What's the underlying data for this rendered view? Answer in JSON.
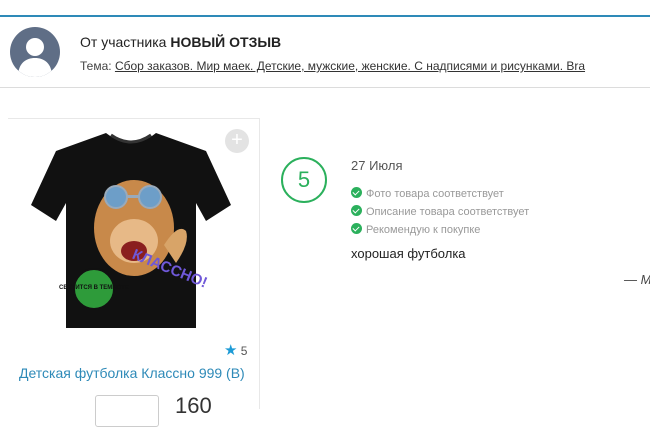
{
  "header": {
    "from_prefix": "От участника",
    "from_name": "НОВЫЙ ОТЗЫВ",
    "topic_label": "Тема:",
    "topic_link": "Сбор заказов. Мир маек. Детские, мужские, женские. С надписями и рисунками. Bra"
  },
  "product": {
    "image_text": "КЛАССНО!",
    "badge_text": "СВЕТИТСЯ В ТЕМНОТЕ",
    "rating": "5",
    "title": "Детская футболка Классно 999 (В)",
    "price": "160",
    "add_icon": "plus-circle-icon"
  },
  "review": {
    "score": "5",
    "date": "27 Июля",
    "checks": [
      "Фото товара соответствует",
      "Описание товара соответствует",
      "Рекомендую к покупке"
    ],
    "text": "хорошая футболка",
    "signature": "— М"
  },
  "colors": {
    "accent": "#2e8ab8",
    "check": "#2bb05c",
    "star": "#1d9bd6",
    "avatar": "#5f6e86"
  }
}
